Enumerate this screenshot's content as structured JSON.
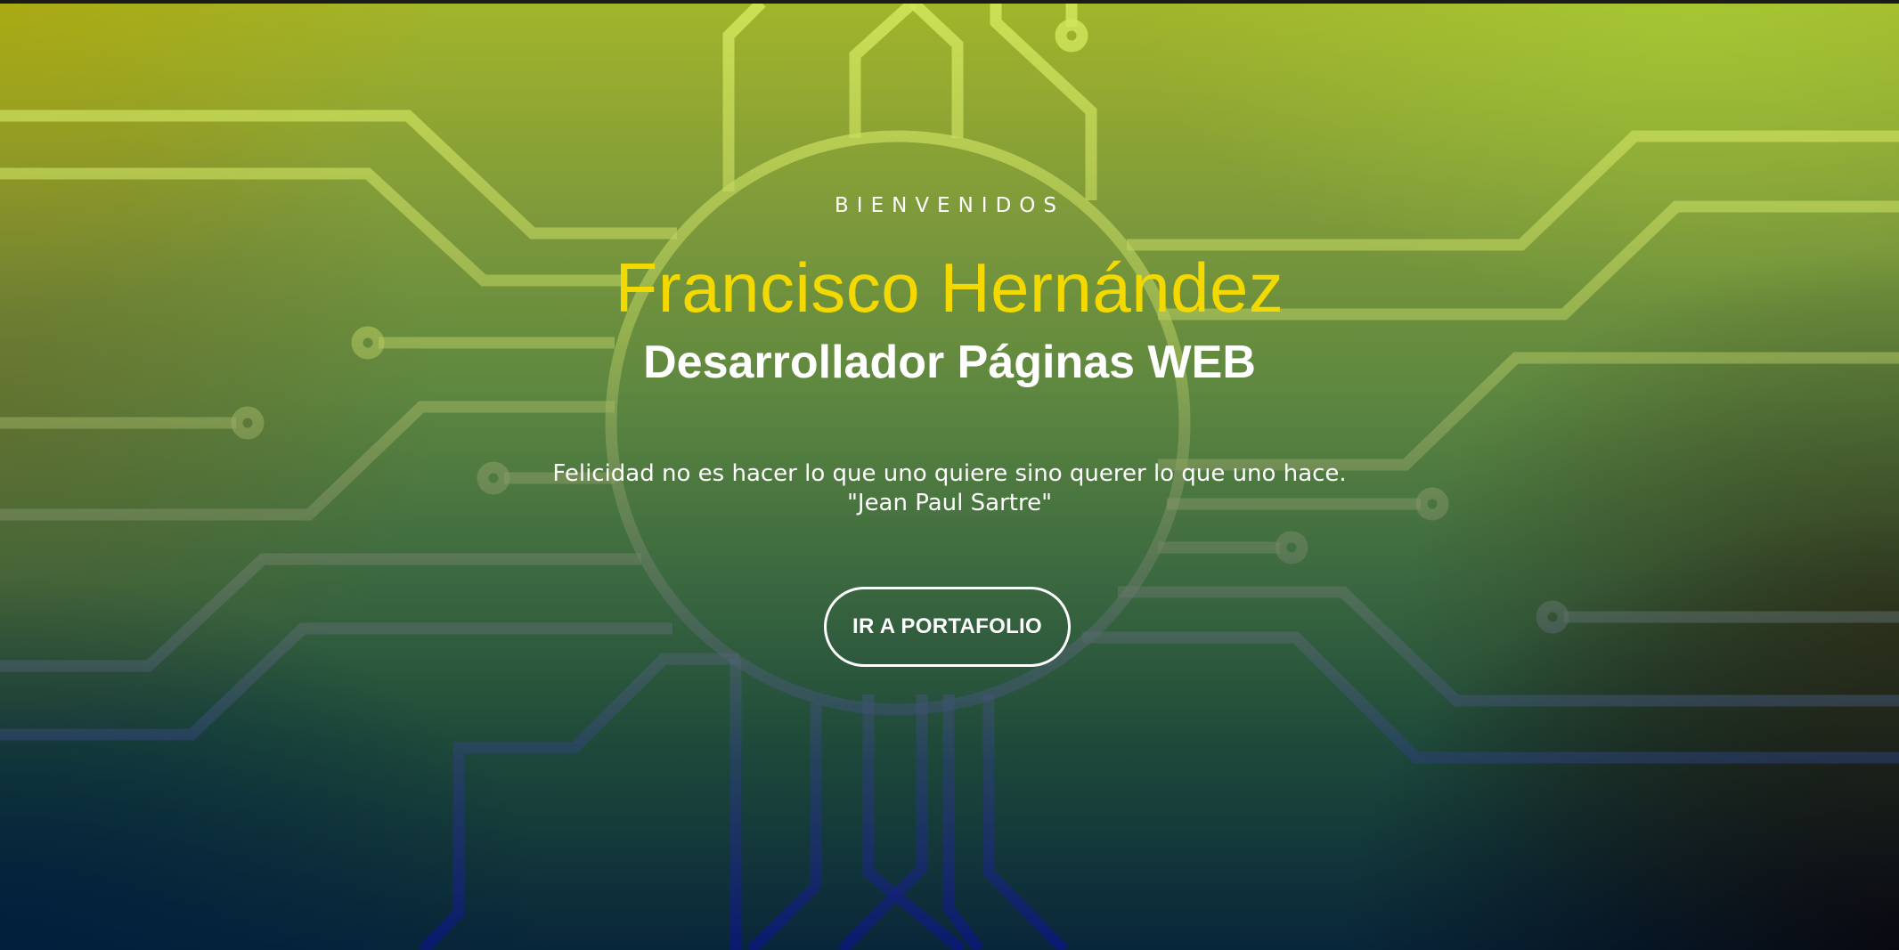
{
  "hero": {
    "eyebrow": "BIENVENIDOS",
    "name": "Francisco Hernández",
    "role": "Desarrollador Páginas WEB",
    "quote_line_1": "Felicidad no es hacer lo que uno quiere sino querer lo que uno hace.",
    "quote_line_2": "\"Jean Paul Sartre\"",
    "cta_label": "IR A PORTAFOLIO"
  },
  "colors": {
    "name_accent": "#f4d900",
    "text": "#ffffff",
    "circuit_top": "#cfe35a",
    "circuit_bottom": "#0c1a7a"
  },
  "background": {
    "motif": "circuit-board-icon"
  }
}
